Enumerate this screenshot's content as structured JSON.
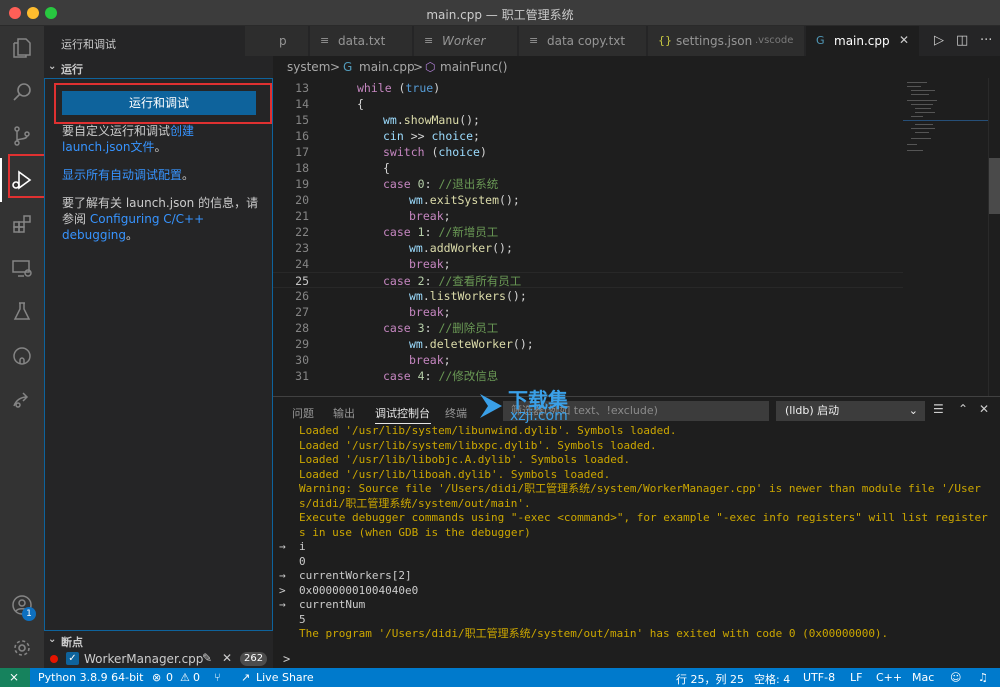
{
  "window": {
    "title": "main.cpp — 职工管理系统"
  },
  "sidebar": {
    "title": "运行和调试",
    "more": "···",
    "run_section_label": "运行",
    "run_button": "运行和调试",
    "customize_text": "要自定义运行和调试",
    "create_link": "创建 launch.json",
    "file_link": "文件",
    "file_suffix": "。",
    "show_all_link": "显示所有自动调试配置",
    "show_all_suffix": "。",
    "learn_more_text": "要了解有关 launch.json 的信息，请参阅",
    "learn_more_link": "Configuring C/C++ debugging",
    "learn_more_suffix": "。",
    "breakpoints_label": "断点",
    "breakpoint": {
      "file": "WorkerManager.cpp",
      "count": "262",
      "checked": true
    }
  },
  "activity_badge": "1",
  "tabs": [
    {
      "label": "p",
      "icon": ""
    },
    {
      "label": "data.txt",
      "icon": "≡"
    },
    {
      "label": "Worker",
      "icon": "≡"
    },
    {
      "label": "data copy.txt",
      "icon": "≡"
    },
    {
      "label": "settings.json",
      "icon": "{}",
      "suffix": ".vscode"
    },
    {
      "label": "main.cpp",
      "icon": "G",
      "active": true
    }
  ],
  "breadcrumb": {
    "folder": "system",
    "separator": ">",
    "file": "main.cpp",
    "symbol": "mainFunc()"
  },
  "editor": {
    "current_line": "25",
    "lines": [
      {
        "n": "13",
        "indent": 4,
        "tokens": [
          {
            "t": "while",
            "c": "kw"
          },
          {
            "t": " (",
            "c": ""
          },
          {
            "t": "true",
            "c": "kwb"
          },
          {
            "t": ")",
            "c": ""
          }
        ]
      },
      {
        "n": "14",
        "indent": 4,
        "tokens": [
          {
            "t": "{",
            "c": ""
          }
        ]
      },
      {
        "n": "15",
        "indent": 8,
        "tokens": [
          {
            "t": "wm",
            "c": "var"
          },
          {
            "t": ".",
            "c": ""
          },
          {
            "t": "showManu",
            "c": "fn"
          },
          {
            "t": "();",
            "c": ""
          }
        ]
      },
      {
        "n": "16",
        "indent": 8,
        "tokens": [
          {
            "t": "cin",
            "c": "var"
          },
          {
            "t": " >> ",
            "c": ""
          },
          {
            "t": "choice",
            "c": "var"
          },
          {
            "t": ";",
            "c": ""
          }
        ]
      },
      {
        "n": "17",
        "indent": 8,
        "tokens": [
          {
            "t": "switch",
            "c": "kw"
          },
          {
            "t": " (",
            "c": ""
          },
          {
            "t": "choice",
            "c": "var"
          },
          {
            "t": ")",
            "c": ""
          }
        ]
      },
      {
        "n": "18",
        "indent": 8,
        "tokens": [
          {
            "t": "{",
            "c": ""
          }
        ]
      },
      {
        "n": "19",
        "indent": 8,
        "tokens": [
          {
            "t": "case",
            "c": "kw"
          },
          {
            "t": " ",
            "c": ""
          },
          {
            "t": "0",
            "c": "num"
          },
          {
            "t": ": ",
            "c": ""
          },
          {
            "t": "//退出系统",
            "c": "cm"
          }
        ]
      },
      {
        "n": "20",
        "indent": 12,
        "tokens": [
          {
            "t": "wm",
            "c": "var"
          },
          {
            "t": ".",
            "c": ""
          },
          {
            "t": "exitSystem",
            "c": "fn"
          },
          {
            "t": "();",
            "c": ""
          }
        ]
      },
      {
        "n": "21",
        "indent": 12,
        "tokens": [
          {
            "t": "break",
            "c": "kw"
          },
          {
            "t": ";",
            "c": ""
          }
        ]
      },
      {
        "n": "22",
        "indent": 8,
        "tokens": [
          {
            "t": "case",
            "c": "kw"
          },
          {
            "t": " ",
            "c": ""
          },
          {
            "t": "1",
            "c": "num"
          },
          {
            "t": ": ",
            "c": ""
          },
          {
            "t": "//新增员工",
            "c": "cm"
          }
        ]
      },
      {
        "n": "23",
        "indent": 12,
        "tokens": [
          {
            "t": "wm",
            "c": "var"
          },
          {
            "t": ".",
            "c": ""
          },
          {
            "t": "addWorker",
            "c": "fn"
          },
          {
            "t": "();",
            "c": ""
          }
        ]
      },
      {
        "n": "24",
        "indent": 12,
        "tokens": [
          {
            "t": "break",
            "c": "kw"
          },
          {
            "t": ";",
            "c": ""
          }
        ]
      },
      {
        "n": "25",
        "indent": 8,
        "tokens": [
          {
            "t": "case",
            "c": "kw"
          },
          {
            "t": " ",
            "c": ""
          },
          {
            "t": "2",
            "c": "num"
          },
          {
            "t": ": ",
            "c": ""
          },
          {
            "t": "//查看所有员工",
            "c": "cm"
          }
        ]
      },
      {
        "n": "26",
        "indent": 12,
        "tokens": [
          {
            "t": "wm",
            "c": "var"
          },
          {
            "t": ".",
            "c": ""
          },
          {
            "t": "listWorkers",
            "c": "fn"
          },
          {
            "t": "();",
            "c": ""
          }
        ]
      },
      {
        "n": "27",
        "indent": 12,
        "tokens": [
          {
            "t": "break",
            "c": "kw"
          },
          {
            "t": ";",
            "c": ""
          }
        ]
      },
      {
        "n": "28",
        "indent": 8,
        "tokens": [
          {
            "t": "case",
            "c": "kw"
          },
          {
            "t": " ",
            "c": ""
          },
          {
            "t": "3",
            "c": "num"
          },
          {
            "t": ": ",
            "c": ""
          },
          {
            "t": "//删除员工",
            "c": "cm"
          }
        ]
      },
      {
        "n": "29",
        "indent": 12,
        "tokens": [
          {
            "t": "wm",
            "c": "var"
          },
          {
            "t": ".",
            "c": ""
          },
          {
            "t": "deleteWorker",
            "c": "fn"
          },
          {
            "t": "();",
            "c": ""
          }
        ]
      },
      {
        "n": "30",
        "indent": 12,
        "tokens": [
          {
            "t": "break",
            "c": "kw"
          },
          {
            "t": ";",
            "c": ""
          }
        ]
      },
      {
        "n": "31",
        "indent": 8,
        "tokens": [
          {
            "t": "case",
            "c": "kw"
          },
          {
            "t": " ",
            "c": ""
          },
          {
            "t": "4",
            "c": "num"
          },
          {
            "t": ": ",
            "c": ""
          },
          {
            "t": "//修改信息",
            "c": "cm"
          }
        ]
      }
    ]
  },
  "panel": {
    "tabs": [
      "问题",
      "输出",
      "调试控制台",
      "终端"
    ],
    "active_tab": "调试控制台",
    "filter": "筛选器(例如 text、!exclude)",
    "launch_config": "(lldb) 启动",
    "console_lines": [
      {
        "text": "Loaded '/usr/lib/system/libunwind.dylib'. Symbols loaded.",
        "cls": "c-warn",
        "mark": ""
      },
      {
        "text": "Loaded '/usr/lib/system/libxpc.dylib'. Symbols loaded.",
        "cls": "c-warn",
        "mark": ""
      },
      {
        "text": "Loaded '/usr/lib/libobjc.A.dylib'. Symbols loaded.",
        "cls": "c-warn",
        "mark": ""
      },
      {
        "text": "Loaded '/usr/lib/liboah.dylib'. Symbols loaded.",
        "cls": "c-warn",
        "mark": ""
      },
      {
        "text": "Warning: Source file '/Users/didi/职工管理系统/system/WorkerManager.cpp' is newer than module file '/Users/didi/职工管理系统/system/out/main'.",
        "cls": "c-warn",
        "mark": ""
      },
      {
        "text": "Execute debugger commands using \"-exec <command>\", for example \"-exec info registers\" will list registers in use (when GDB is the debugger)",
        "cls": "c-warn",
        "mark": ""
      },
      {
        "text": "i",
        "cls": "c-norm",
        "mark": "→"
      },
      {
        "text": "0",
        "cls": "c-norm",
        "mark": ""
      },
      {
        "text": "currentWorkers[2]",
        "cls": "c-norm",
        "mark": "→"
      },
      {
        "text": "0x00000001004040e0",
        "cls": "c-norm",
        "mark": ">"
      },
      {
        "text": "currentNum",
        "cls": "c-norm",
        "mark": "→"
      },
      {
        "text": "5",
        "cls": "c-norm",
        "mark": ""
      },
      {
        "text": "The program '/Users/didi/职工管理系统/system/out/main' has exited with code 0 (0x00000000).",
        "cls": "c-warn",
        "mark": ""
      }
    ],
    "prompt": ">"
  },
  "statusbar": {
    "python": "Python 3.8.9 64-bit",
    "errors": "0",
    "warnings": "0",
    "live_share": "Live Share",
    "position": "行 25，列 25",
    "spaces": "空格: 4",
    "encoding": "UTF-8",
    "eol": "LF",
    "language": "C++",
    "platform": "Mac"
  },
  "watermark": {
    "title": "下载集",
    "sub": "xzji.com"
  }
}
